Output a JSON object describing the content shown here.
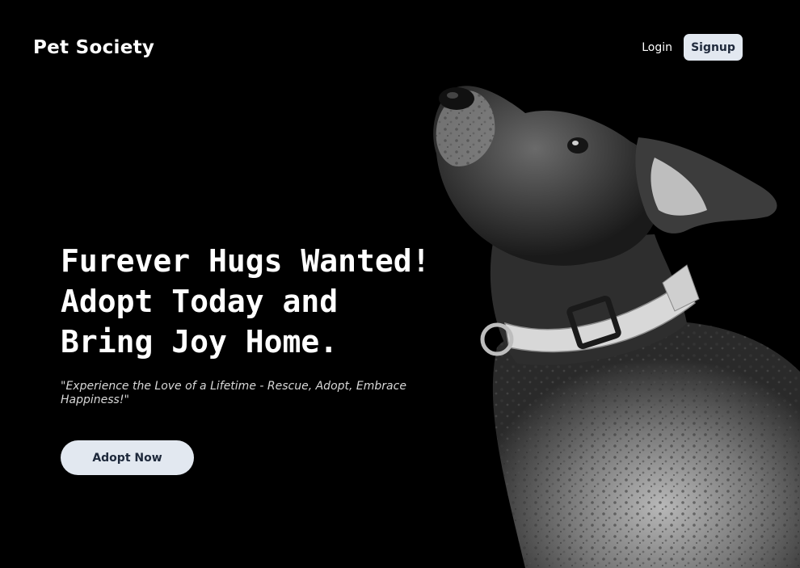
{
  "header": {
    "brand": "Pet Society",
    "login_label": "Login",
    "signup_label": "Signup"
  },
  "hero": {
    "headline_lines": [
      "Furever Hugs Wanted!",
      "Adopt Today and",
      "Bring Joy Home."
    ],
    "tagline": "\"Experience the Love of a Lifetime - Rescue, Adopt, Embrace Happiness!\"",
    "cta_label": "Adopt Now",
    "image_subject": "black-and-white dog with collar looking up"
  },
  "colors": {
    "background": "#000000",
    "button_bg": "#e2e8f0",
    "button_text": "#1e293b",
    "text": "#ffffff"
  }
}
